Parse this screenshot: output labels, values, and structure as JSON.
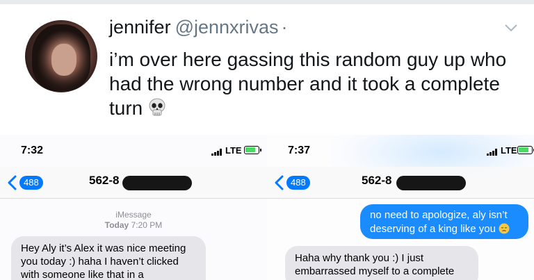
{
  "tweet": {
    "display_name": "jennifer",
    "handle": "@jennxrivas",
    "separator": "·",
    "text": "i’m over here gassing this random guy up who had the wrong number and it took a complete turn",
    "emoji": "skull-icon"
  },
  "screens": [
    {
      "status": {
        "time": "7:32",
        "network": "LTE"
      },
      "nav": {
        "back_count": "488",
        "contact": "562-8"
      },
      "thread": {
        "service": "iMessage",
        "day": "Today",
        "time": "7:20 PM",
        "incoming": "Hey Aly it’s Alex it was nice meeting you today :) haha I haven’t clicked with someone like that in a"
      }
    },
    {
      "status": {
        "time": "7:37",
        "network": "LTE"
      },
      "nav": {
        "back_count": "488",
        "contact": "562-8"
      },
      "thread": {
        "outgoing": "no need to apologize, aly isn’t deserving of a king like you",
        "outgoing_emoji": "pensive-face-icon",
        "incoming": "Haha why thank you :) I just embarrassed myself to a complete"
      }
    }
  ],
  "colors": {
    "imessage_blue": "#1a8cff",
    "badge_blue": "#007aff",
    "incoming_gray": "#e5e5ea",
    "battery_green": "#4cd964",
    "twitter_gray": "#657786"
  }
}
